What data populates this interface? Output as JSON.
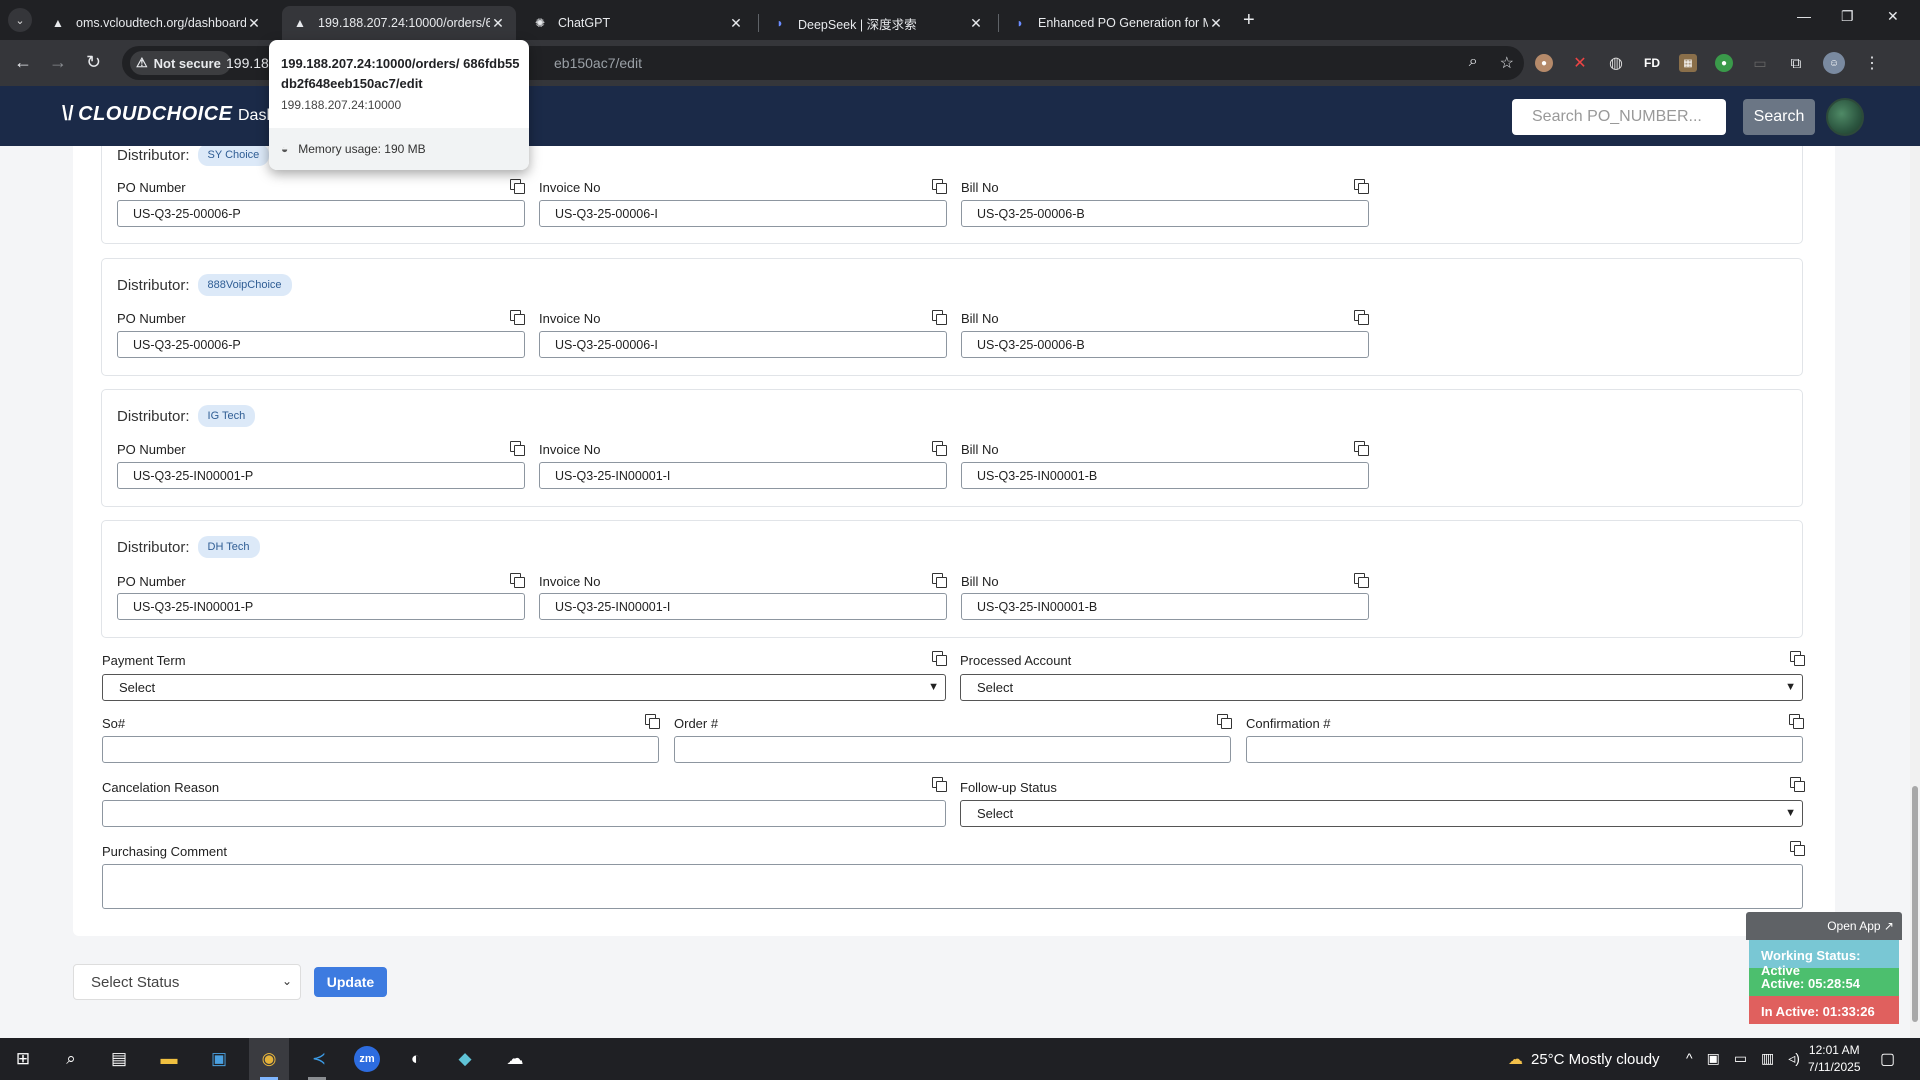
{
  "browser": {
    "tabs": [
      {
        "title": "oms.vcloudtech.org/dashboard",
        "favicon": "triangle-icon"
      },
      {
        "title": "199.188.207.24:10000/orders/6",
        "favicon": "triangle-icon"
      },
      {
        "title": "ChatGPT",
        "favicon": "openai-icon"
      },
      {
        "title": "DeepSeek | 深度求索",
        "favicon": "deepseek-icon"
      },
      {
        "title": "Enhanced PO Generation for M",
        "favicon": "deepseek-icon"
      }
    ],
    "security_label": "Not secure",
    "url_visible_start": "199.18",
    "url_visible_end": "eb150ac7/edit",
    "hovercard": {
      "url": "199.188.207.24:10000/orders/ 686fdb55db2f648eeb150ac7/edit",
      "host": "199.188.207.24:10000",
      "memory": "Memory usage: 190 MB"
    }
  },
  "app": {
    "logo": "CLOUDCHOICE",
    "nav_first": "Dash",
    "search_placeholder": "Search PO_NUMBER...",
    "search_button": "Search"
  },
  "form": {
    "distributor_label": "Distributor:",
    "field_labels": {
      "po": "PO Number",
      "invoice": "Invoice No",
      "bill": "Bill No"
    },
    "distributors": [
      {
        "name": "SY Choice",
        "po": "US-Q3-25-00006-P",
        "invoice": "US-Q3-25-00006-I",
        "bill": "US-Q3-25-00006-B"
      },
      {
        "name": "888VoipChoice",
        "po": "US-Q3-25-00006-P",
        "invoice": "US-Q3-25-00006-I",
        "bill": "US-Q3-25-00006-B"
      },
      {
        "name": "IG Tech",
        "po": "US-Q3-25-IN00001-P",
        "invoice": "US-Q3-25-IN00001-I",
        "bill": "US-Q3-25-IN00001-B"
      },
      {
        "name": "DH Tech",
        "po": "US-Q3-25-IN00001-P",
        "invoice": "US-Q3-25-IN00001-I",
        "bill": "US-Q3-25-IN00001-B"
      }
    ],
    "payment_term_label": "Payment Term",
    "payment_term_value": "Select",
    "processed_account_label": "Processed Account",
    "processed_account_value": "Select",
    "so_label": "So#",
    "order_label": "Order #",
    "confirmation_label": "Confirmation #",
    "cancel_reason_label": "Cancelation Reason",
    "followup_label": "Follow-up Status",
    "followup_value": "Select",
    "comment_label": "Purchasing Comment",
    "status_select": "Select Status",
    "update_button": "Update"
  },
  "widget": {
    "open_app": "Open App ↗",
    "working_status": "Working Status: Active",
    "active": "Active: 05:28:54",
    "inactive": "In Active: 01:33:26"
  },
  "taskbar": {
    "weather": "25°C  Mostly cloudy",
    "time": "12:01 AM",
    "date": "7/11/2025"
  },
  "colors": {
    "appbar": "#1b2a48",
    "badge_bg": "#dce9f8",
    "update_button": "#3d7be0",
    "status_active": "#4cbf6e",
    "status_inactive": "#e0605e"
  }
}
